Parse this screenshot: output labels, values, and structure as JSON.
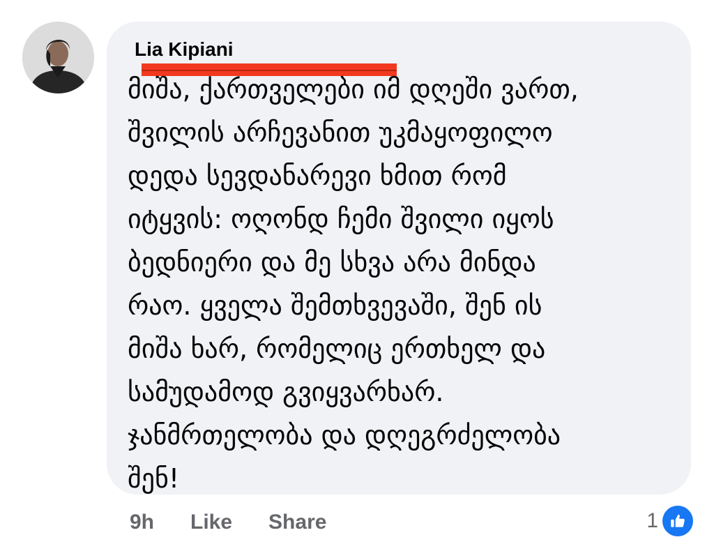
{
  "comment": {
    "author": "Lia Kipiani",
    "text_lines": [
      "მიშა, ქართველები იმ დღეში ვართ,",
      "შვილის არჩევანით უკმაყოფილო",
      "დედა სევდანარევი ხმით რომ",
      "იტყვის: ოღონდ ჩემი შვილი იყოს",
      "ბედნიერი და მე სხვა არა მინდა",
      "რაო. ყველა შემთხვევაში, შენ ის",
      "მიშა ხარ, რომელიც ერთხელ და",
      "სამუდამოდ გვიყვარხარ.",
      "ჯანმრთელობა და დღეგრძელობა",
      "შენ!"
    ]
  },
  "actions": {
    "time": "9h",
    "like_label": "Like",
    "share_label": "Share"
  },
  "reactions": {
    "count": "1",
    "icon": "thumbs-up-icon",
    "color": "#1877f2"
  },
  "colors": {
    "bubble": "#f0f2f5",
    "redaction": "#f2391f",
    "secondary_text": "#65676b"
  }
}
